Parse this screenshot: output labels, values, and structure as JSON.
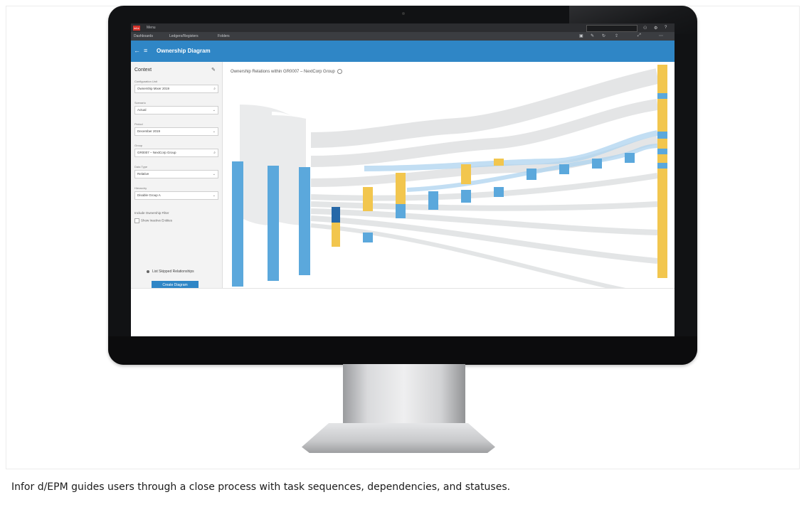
{
  "caption": "Infor d/EPM guides users through a close process with task sequences, dependencies, and statuses.",
  "app": {
    "logo": "infor",
    "app_name": "Menu",
    "menu_items": [
      "Dashboards",
      "Ledgers/Registers",
      "Folders"
    ],
    "page_title": "Ownership Diagram"
  },
  "sidebar": {
    "header": "Context",
    "fields": [
      {
        "label": "Configuration Unit",
        "value": "Ownership Mixer 2019"
      },
      {
        "label": "Scenario",
        "value": "Actual"
      },
      {
        "label": "Period",
        "value": "December 2019"
      },
      {
        "label": "Group",
        "value": "GR0007 – NextCorp Group"
      },
      {
        "label": "Data Type",
        "value": "Relative"
      },
      {
        "label": "Hierarchy",
        "value": "Disable Group A"
      }
    ],
    "option_label": "Include Ownership Filter",
    "checkbox_label": "Show Inactive Entities",
    "radio_label": "List Skipped Relationships",
    "button_label": "Create Diagram"
  },
  "chart": {
    "title": "Ownership Relations within GR0007 – NextCorp Group"
  },
  "colors": {
    "brand_blue": "#2f86c6",
    "node_blue": "#5ba8dc",
    "node_yellow": "#f2c64e",
    "link_grey": "#d8dadc"
  }
}
